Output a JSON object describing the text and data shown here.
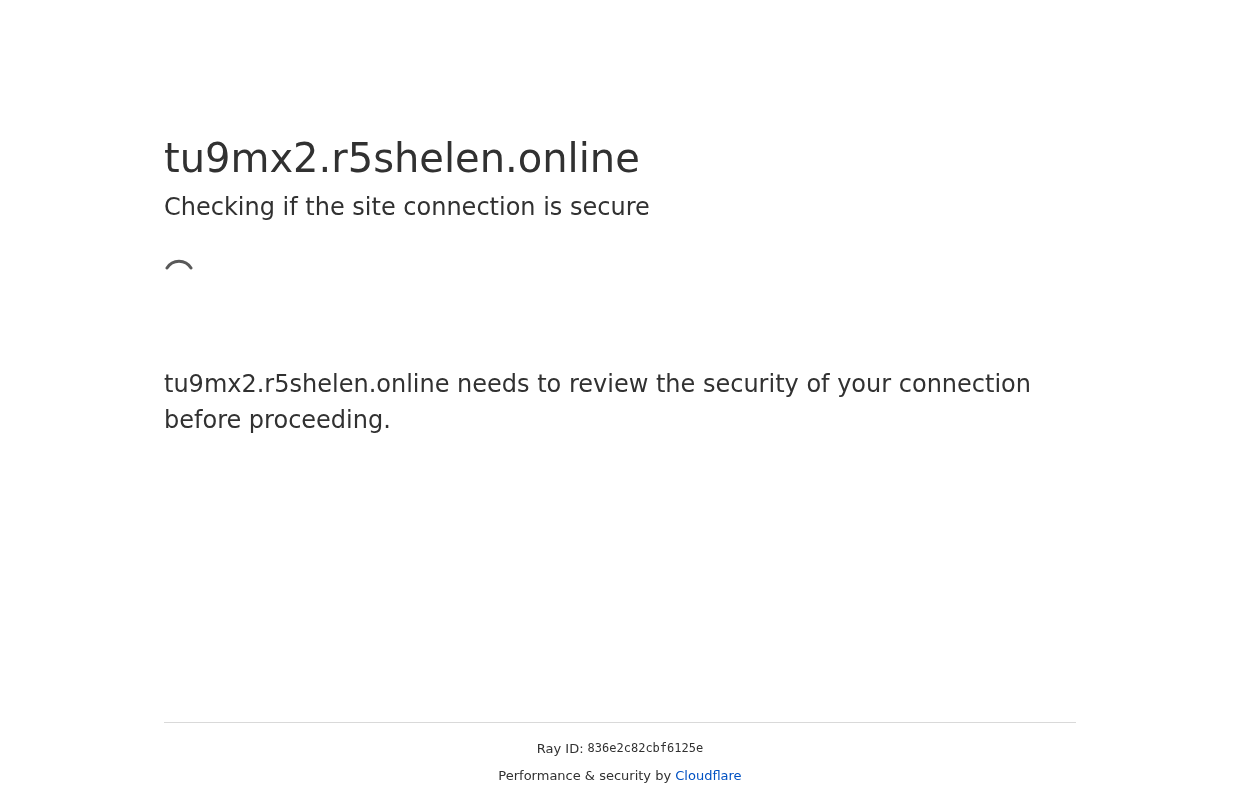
{
  "title": "tu9mx2.r5shelen.online",
  "subtitle": "Checking if the site connection is secure",
  "message": "tu9mx2.r5shelen.online needs to review the security of your connection before proceeding.",
  "footer": {
    "ray_id_label": "Ray ID:",
    "ray_id": "836e2c82cbf6125e",
    "attribution": "Performance & security by",
    "link": "Cloudflare"
  }
}
